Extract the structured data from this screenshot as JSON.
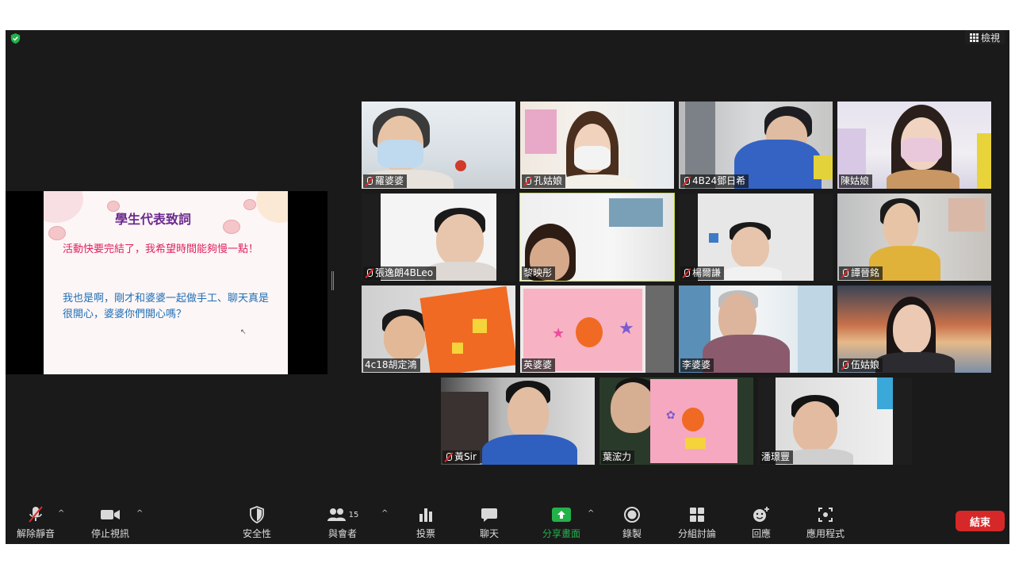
{
  "view_button": {
    "label": "檢視"
  },
  "shared_slide": {
    "title": "學生代表致詞",
    "line1": "活動快要完結了，我希望時間能夠慢一點！",
    "line2": "我也是啊，剛才和婆婆一起做手工、聊天真是很開心，婆婆你們開心嗎？"
  },
  "participants": [
    {
      "name": "羅婆婆",
      "muted": true
    },
    {
      "name": "孔姑娘",
      "muted": true
    },
    {
      "name": "4B24鄧日希",
      "muted": true
    },
    {
      "name": "陳姑娘",
      "muted": false
    },
    {
      "name": "張逸朗4BLeo",
      "muted": true
    },
    {
      "name": "黎映彤",
      "muted": false,
      "active_speaker": true
    },
    {
      "name": "楊爾謙",
      "muted": true
    },
    {
      "name": "譚晉銘",
      "muted": true
    },
    {
      "name": "4c18胡定鴻",
      "muted": false
    },
    {
      "name": "英婆婆",
      "muted": false
    },
    {
      "name": "李婆婆",
      "muted": false
    },
    {
      "name": "伍姑娘",
      "muted": true
    },
    {
      "name": "黃Sir",
      "muted": true
    },
    {
      "name": "葉浤力",
      "muted": false
    },
    {
      "name": "潘璟豐",
      "muted": false
    }
  ],
  "toolbar": {
    "unmute_label": "解除靜音",
    "stop_video_label": "停止視訊",
    "security_label": "安全性",
    "participants_label": "與會者",
    "participants_count": "15",
    "polls_label": "投票",
    "chat_label": "聊天",
    "share_screen_label": "分享畫面",
    "record_label": "錄製",
    "breakout_label": "分組討論",
    "reactions_label": "回應",
    "apps_label": "應用程式",
    "end_label": "結束"
  },
  "colors": {
    "background": "#1a1a1a",
    "active_speaker_border": "#c8d83a",
    "share_green": "#23b24a",
    "end_red": "#d62828",
    "slide_title": "#6b2a8f",
    "slide_pink": "#e0245e",
    "slide_blue": "#1f6fb4"
  }
}
